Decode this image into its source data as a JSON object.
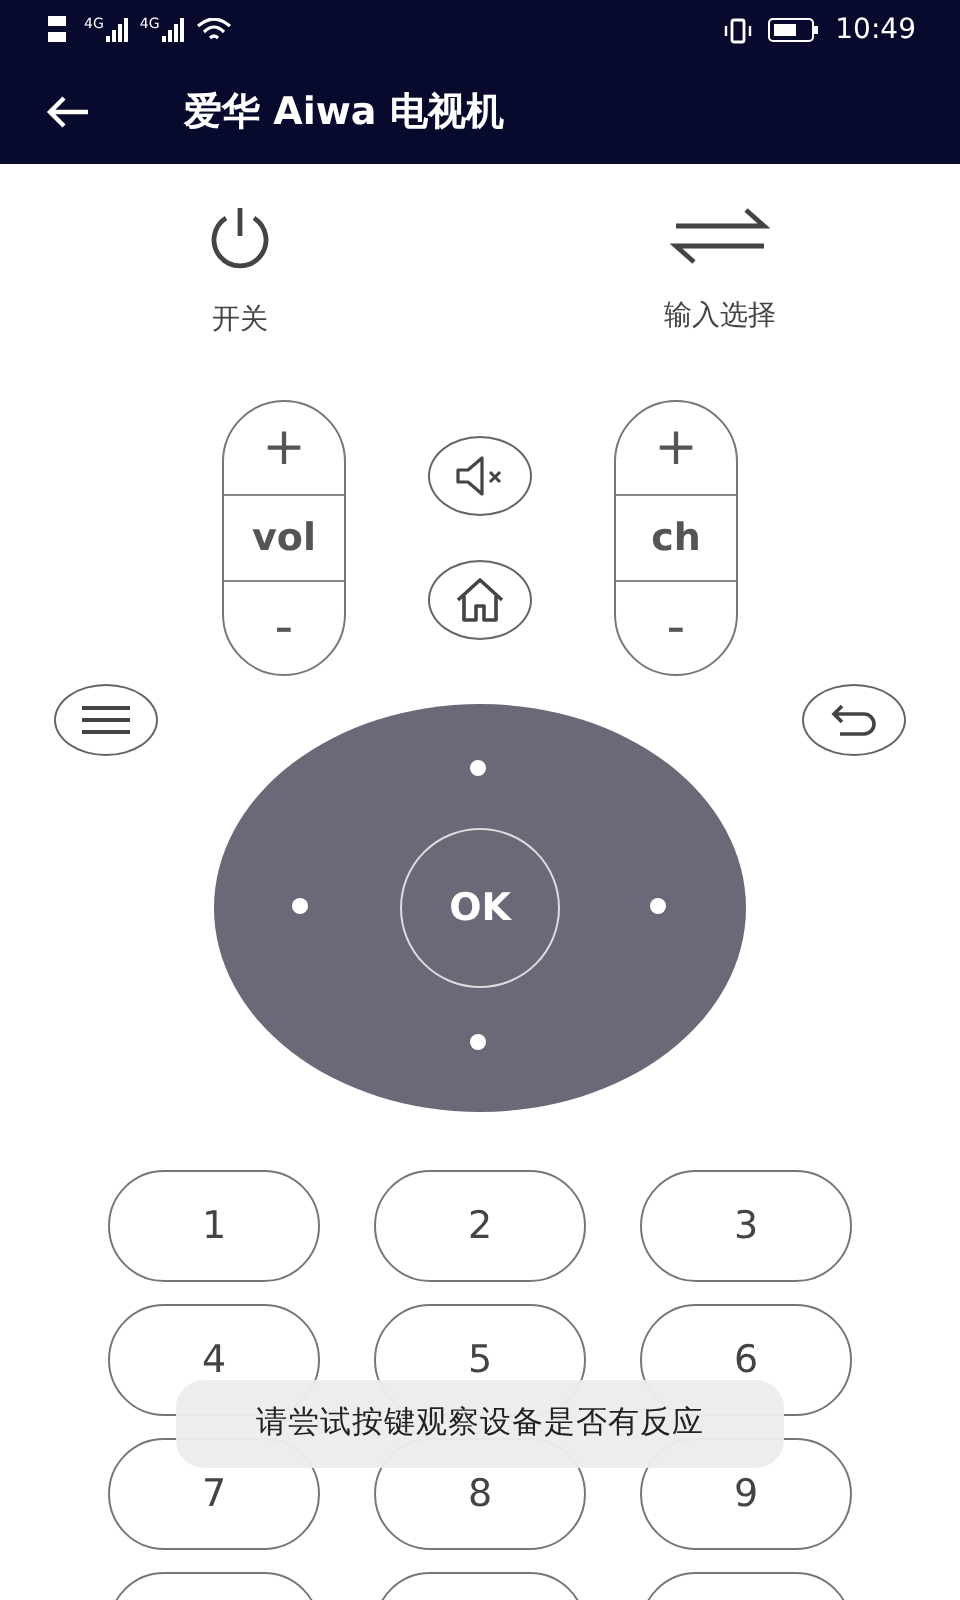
{
  "status_bar": {
    "signals": [
      {
        "label": "4G"
      },
      {
        "label": "4G"
      }
    ],
    "time": "10:49"
  },
  "app_bar": {
    "title": "爱华 Aiwa 电视机"
  },
  "top_buttons": [
    {
      "kind": "power",
      "label": "开关"
    },
    {
      "kind": "input",
      "label": "输入选择"
    }
  ],
  "rockers": [
    {
      "plus": "+",
      "label": "vol",
      "minus": "-"
    },
    {
      "plus": "+",
      "label": "ch",
      "minus": "-"
    }
  ],
  "dpad": {
    "ok": "OK"
  },
  "keypad": [
    "1",
    "2",
    "3",
    "4",
    "5",
    "6",
    "7",
    "8",
    "9"
  ],
  "toast": "请尝试按键观察设备是否有反应"
}
